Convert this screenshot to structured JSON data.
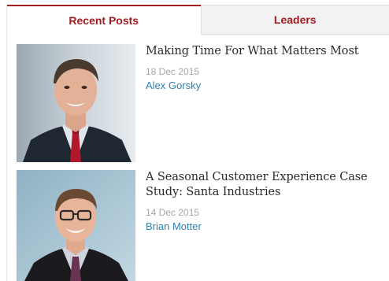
{
  "tabs": [
    {
      "label": "Recent Posts",
      "active": true
    },
    {
      "label": "Leaders",
      "active": false
    }
  ],
  "posts": [
    {
      "title": "Making Time For What Matters Most",
      "date": "18 Dec 2015",
      "author": "Alex Gorsky",
      "photo": "author-photo"
    },
    {
      "title": "A Seasonal Customer Experience Case Study: Santa Industries",
      "date": "14 Dec 2015",
      "author": "Brian Motter",
      "photo": "author-photo"
    }
  ],
  "colors": {
    "accent": "#a31c22",
    "link": "#2f7fb0",
    "date": "#a6a6a6",
    "tab_inactive_bg": "#f2f2f2"
  }
}
